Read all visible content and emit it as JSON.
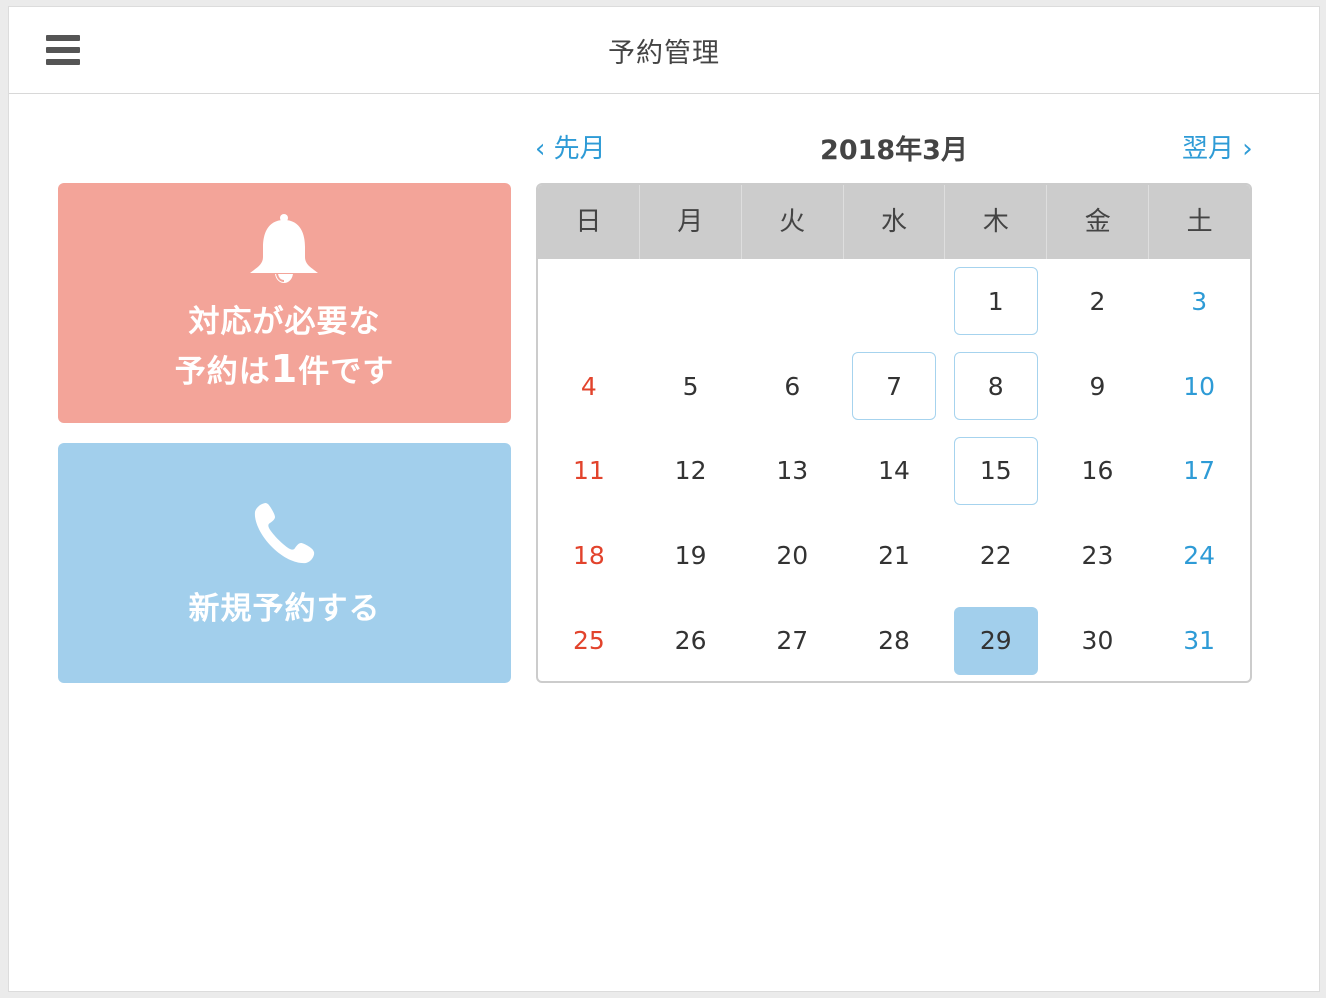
{
  "header": {
    "title": "予約管理",
    "menu_icon": "hamburger-menu-icon"
  },
  "alert_card": {
    "icon": "bell-icon",
    "line1": "対応が必要な",
    "line2_prefix": "予約は",
    "line2_count": "1",
    "line2_suffix": "件です",
    "color": "#f3a499"
  },
  "reserve_card": {
    "icon": "phone-icon",
    "label": "新規予約する",
    "color": "#a2cfec"
  },
  "calendar": {
    "prev_label": "‹ 先月",
    "next_label": "翌月 ›",
    "month_label": "2018年3月",
    "weekdays": [
      "日",
      "月",
      "火",
      "水",
      "木",
      "金",
      "土"
    ],
    "weeks": [
      [
        "",
        "",
        "",
        "",
        "1",
        "2",
        "3"
      ],
      [
        "4",
        "5",
        "6",
        "7",
        "8",
        "9",
        "10"
      ],
      [
        "11",
        "12",
        "13",
        "14",
        "15",
        "16",
        "17"
      ],
      [
        "18",
        "19",
        "20",
        "21",
        "22",
        "23",
        "24"
      ],
      [
        "25",
        "26",
        "27",
        "28",
        "29",
        "30",
        "31"
      ]
    ],
    "reserved_days": [
      "1",
      "7",
      "8",
      "15"
    ],
    "selected_day": "29",
    "sunday_color": "#e2432c",
    "saturday_color": "#2e9bd6",
    "highlight_color": "#a2cfec"
  }
}
